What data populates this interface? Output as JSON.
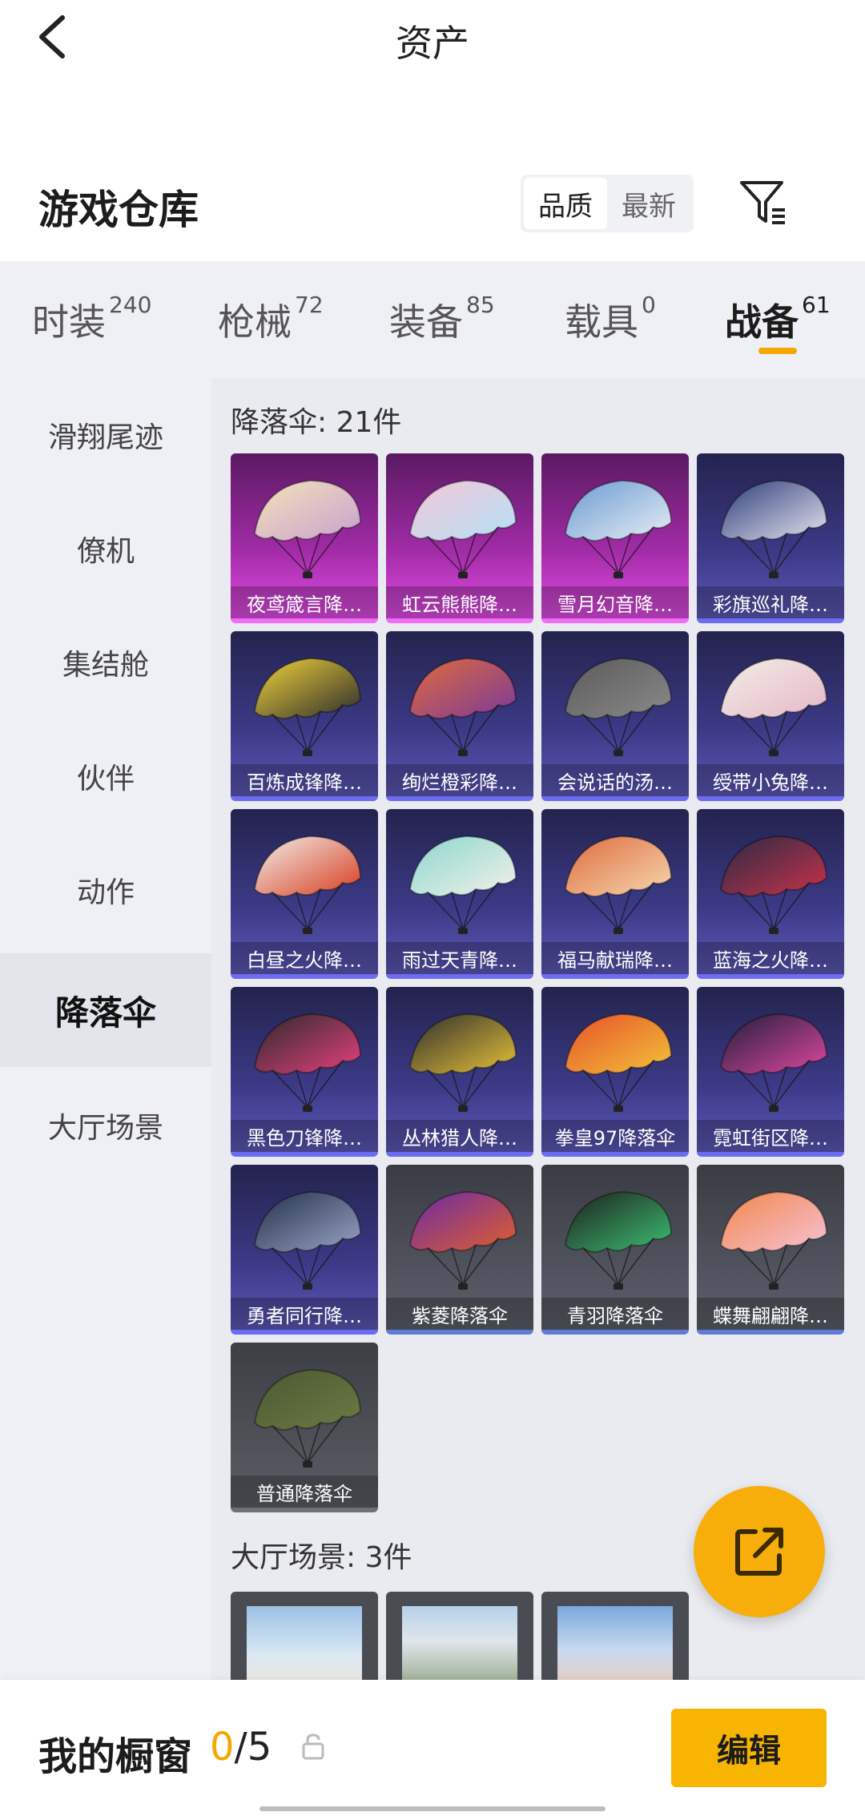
{
  "header": {
    "title": "资产",
    "back_icon": "chevron-left-icon"
  },
  "warehouse": {
    "title": "游戏仓库",
    "sort_options": [
      {
        "label": "品质",
        "active": true
      },
      {
        "label": "最新",
        "active": false
      }
    ],
    "filter_icon": "filter-icon"
  },
  "tabs": [
    {
      "label": "时装",
      "count": "240",
      "active": false
    },
    {
      "label": "枪械",
      "count": "72",
      "active": false
    },
    {
      "label": "装备",
      "count": "85",
      "active": false
    },
    {
      "label": "载具",
      "count": "0",
      "active": false
    },
    {
      "label": "战备",
      "count": "61",
      "active": true
    }
  ],
  "accent_color": "#f5a700",
  "sidebar": {
    "items": [
      {
        "label": "滑翔尾迹",
        "active": false
      },
      {
        "label": "僚机",
        "active": false
      },
      {
        "label": "集结舱",
        "active": false
      },
      {
        "label": "伙伴",
        "active": false
      },
      {
        "label": "动作",
        "active": false
      },
      {
        "label": "降落伞",
        "active": true
      },
      {
        "label": "大厅场景",
        "active": false
      }
    ]
  },
  "parachutes": {
    "title": "降落伞: 21件",
    "items": [
      {
        "name": "夜鸢箴言降…",
        "rarity": "pink"
      },
      {
        "name": "虹云熊熊降…",
        "rarity": "pink"
      },
      {
        "name": "雪月幻音降…",
        "rarity": "pink"
      },
      {
        "name": "彩旗巡礼降…",
        "rarity": "purple"
      },
      {
        "name": "百炼成锋降…",
        "rarity": "purple"
      },
      {
        "name": "绚烂橙彩降…",
        "rarity": "purple"
      },
      {
        "name": "会说话的汤…",
        "rarity": "purple"
      },
      {
        "name": "绶带小兔降…",
        "rarity": "purple"
      },
      {
        "name": "白昼之火降…",
        "rarity": "purple"
      },
      {
        "name": "雨过天青降…",
        "rarity": "purple"
      },
      {
        "name": "福马献瑞降…",
        "rarity": "purple"
      },
      {
        "name": "蓝海之火降…",
        "rarity": "purple"
      },
      {
        "name": "黑色刀锋降…",
        "rarity": "purple"
      },
      {
        "name": "丛林猎人降…",
        "rarity": "purple"
      },
      {
        "name": "拳皇97降落伞",
        "rarity": "purple"
      },
      {
        "name": "霓虹街区降…",
        "rarity": "purple"
      },
      {
        "name": "勇者同行降…",
        "rarity": "purple"
      },
      {
        "name": "紫菱降落伞",
        "rarity": "gray"
      },
      {
        "name": "青羽降落伞",
        "rarity": "gray"
      },
      {
        "name": "蝶舞翩翩降…",
        "rarity": "gray"
      },
      {
        "name": "普通降落伞",
        "rarity": "plain"
      }
    ]
  },
  "scenes": {
    "title": "大厅场景: 3件",
    "count": 3
  },
  "share_icon": "share-icon",
  "bottom": {
    "window_label": "我的橱窗",
    "current": "0",
    "separator": "/",
    "total": "5",
    "lock_icon": "lock-icon",
    "edit_label": "编辑"
  }
}
